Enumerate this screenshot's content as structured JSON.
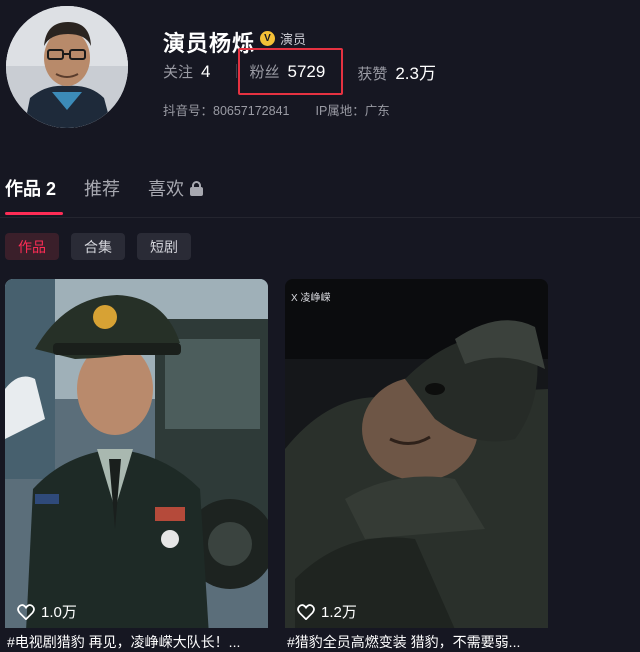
{
  "profile": {
    "name": "演员杨烁",
    "verify_badge": "V",
    "verify_label": "演员",
    "stats": {
      "following_label": "关注",
      "following_value": "4",
      "followers_label": "粉丝",
      "followers_value": "5729",
      "likes_label": "获赞",
      "likes_value": "2.3万"
    },
    "douyin_id": "抖音号：80657172841",
    "ip_location": "IP属地：广东"
  },
  "tabs": [
    {
      "label": "作品 2",
      "active": true
    },
    {
      "label": "推荐",
      "active": false
    },
    {
      "label": "喜欢",
      "active": false,
      "icon": "lock-icon"
    }
  ],
  "filters": [
    {
      "label": "作品",
      "active": true
    },
    {
      "label": "合集",
      "active": false
    },
    {
      "label": "短剧",
      "active": false
    }
  ],
  "videos": [
    {
      "likes": "1.0万",
      "caption": "#电视剧猎豹 再见，凌峥嵘大队长！..."
    },
    {
      "likes": "1.2万",
      "caption": "#猎豹全员高燃变装 猎豹，不需要弱...",
      "watermark": "X 凌峥嵘"
    }
  ],
  "colors": {
    "background": "#161722",
    "accent": "#fe2c55",
    "highlight_box": "#e53241",
    "verify_badge": "#f4c037"
  }
}
